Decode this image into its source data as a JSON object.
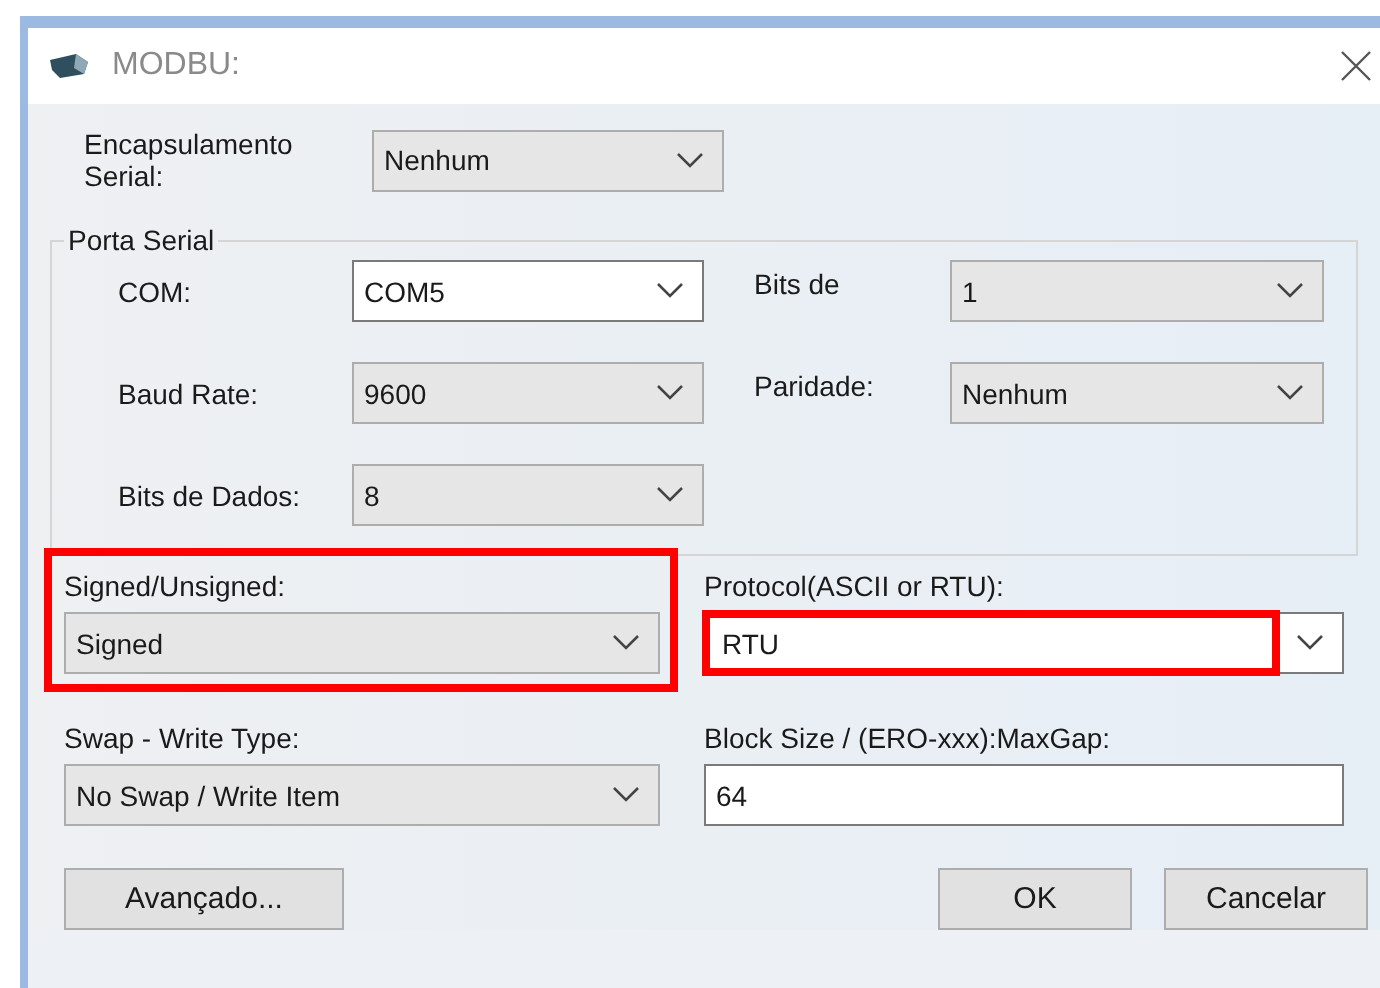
{
  "window": {
    "title": "MODBU:"
  },
  "encapsulation": {
    "label": "Encapsulamento Serial:",
    "value": "Nenhum",
    "kind": "list"
  },
  "serial_port": {
    "title": "Porta Serial",
    "fields": [
      {
        "label": "COM:",
        "value": "COM5",
        "kind": "combo"
      },
      {
        "label": "Bits de",
        "value": "1",
        "kind": "list"
      },
      {
        "label": "Baud Rate:",
        "value": "9600",
        "kind": "list"
      },
      {
        "label": "Paridade:",
        "value": "Nenhum",
        "kind": "list"
      },
      {
        "label": "Bits de Dados:",
        "value": "8",
        "kind": "list"
      }
    ]
  },
  "options": [
    {
      "label": "Signed/Unsigned:",
      "value": "Signed",
      "kind": "list",
      "framed": true,
      "value_framed": false
    },
    {
      "label": "Protocol(ASCII or RTU):",
      "value": "RTU",
      "kind": "combo",
      "framed": false,
      "value_framed": true
    },
    {
      "label": "Swap - Write Type:",
      "value": "No Swap / Write Item",
      "kind": "list",
      "framed": false,
      "value_framed": false
    },
    {
      "label": "Block Size / (ERO-xxx):MaxGap:",
      "value": "64",
      "kind": "text",
      "framed": false,
      "value_framed": false
    }
  ],
  "buttons": [
    {
      "label": "Avançado..."
    },
    {
      "label": "OK"
    },
    {
      "label": "Cancelar"
    }
  ]
}
